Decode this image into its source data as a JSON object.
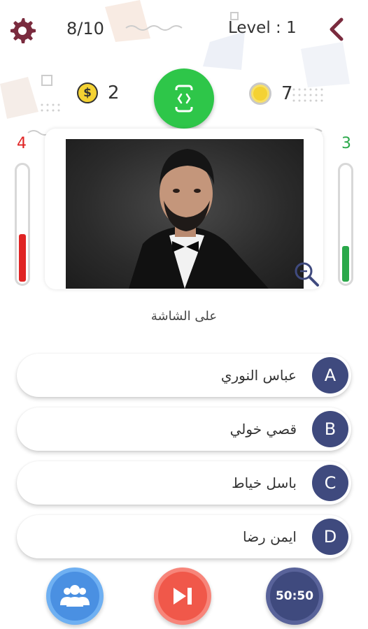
{
  "header": {
    "progress": "8/10",
    "level": "Level : 1"
  },
  "counters": {
    "cash": "2",
    "coins": "7"
  },
  "gauges": {
    "left_value": "4",
    "left_fill_fraction": 0.4,
    "left_color": "#e02424",
    "right_value": "3",
    "right_fill_fraction": 0.3,
    "right_color": "#2aa84a"
  },
  "question": {
    "hint": "على الشاشة"
  },
  "answers": [
    {
      "letter": "A",
      "text": "عباس النوري"
    },
    {
      "letter": "B",
      "text": "قصي خولي"
    },
    {
      "letter": "C",
      "text": "باسل خياط"
    },
    {
      "letter": "D",
      "text": "ايمن رضا"
    }
  ],
  "lifelines": {
    "fifty_fifty": "50:50"
  },
  "colors": {
    "accent_green": "#2ec649",
    "answer_badge": "#3f4a7e",
    "audience_blue": "#4a90e2",
    "skip_red": "#f0584a",
    "fifty_navy": "#3f4a7e"
  }
}
